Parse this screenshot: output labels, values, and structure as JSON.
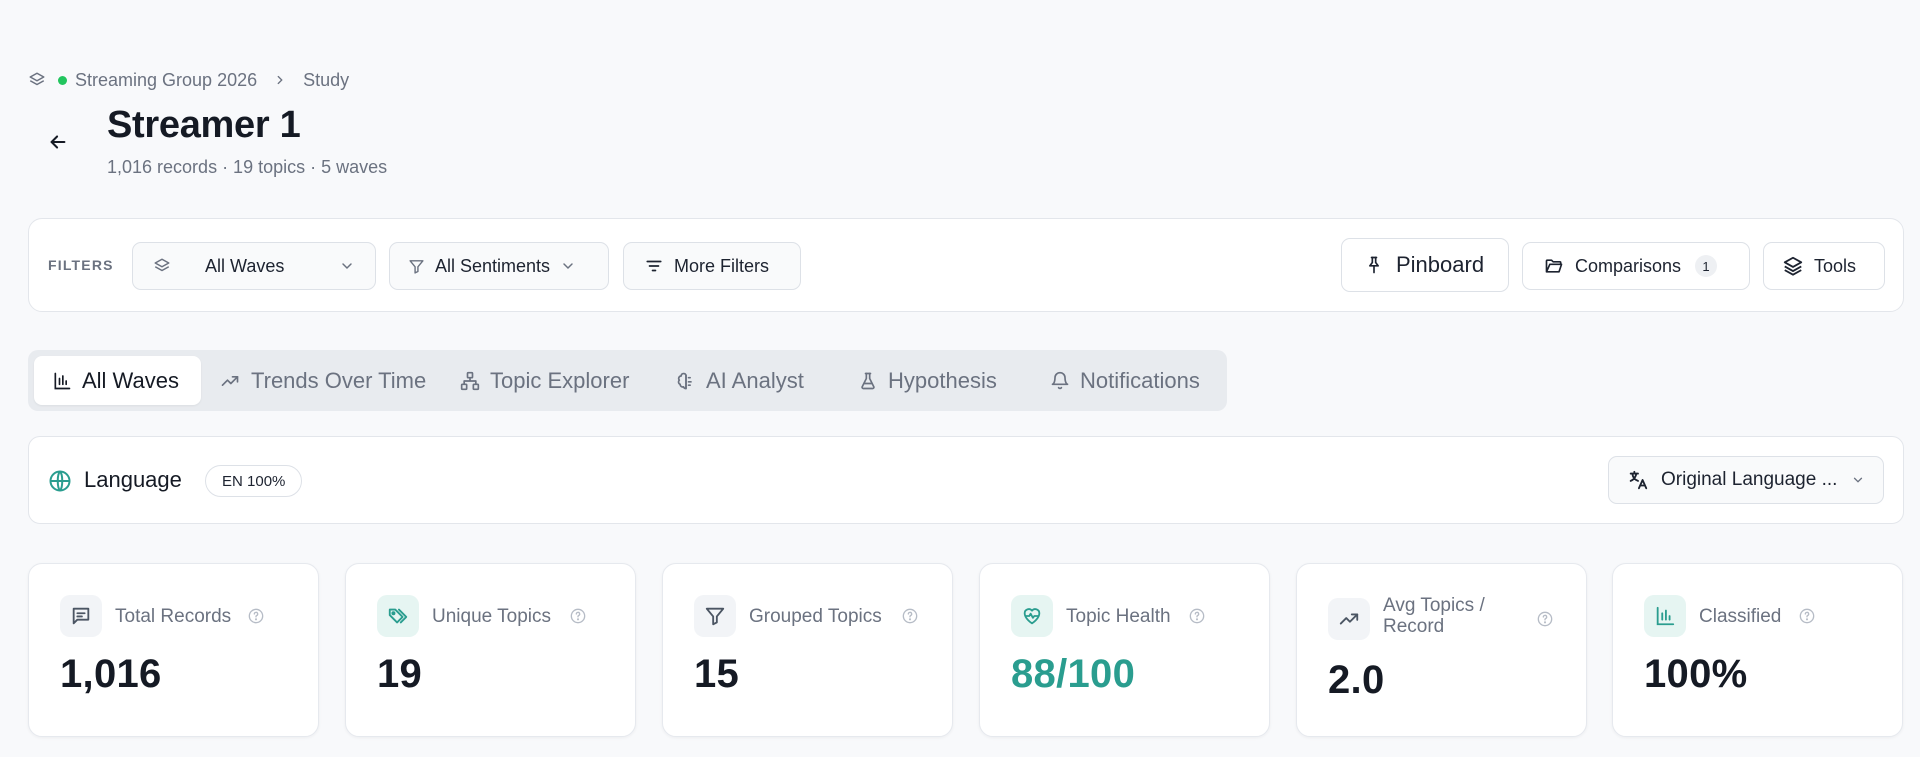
{
  "breadcrumb": {
    "group": "Streaming Group 2026",
    "current": "Study"
  },
  "header": {
    "title": "Streamer 1",
    "subtitle": "1,016 records · 19 topics · 5 waves"
  },
  "filters": {
    "label": "FILTERS",
    "waves": "All Waves",
    "sentiments": "All Sentiments",
    "more": "More Filters",
    "pinboard": "Pinboard",
    "comparisons": "Comparisons",
    "comparisons_count": "1",
    "tools": "Tools"
  },
  "tabs": [
    {
      "label": "All Waves",
      "icon": "bar-chart-icon",
      "active": true
    },
    {
      "label": "Trends Over Time",
      "icon": "trending-up-icon"
    },
    {
      "label": "Topic Explorer",
      "icon": "network-icon"
    },
    {
      "label": "AI Analyst",
      "icon": "brain-icon"
    },
    {
      "label": "Hypothesis",
      "icon": "flask-icon"
    },
    {
      "label": "Notifications",
      "icon": "bell-icon"
    }
  ],
  "language": {
    "title": "Language",
    "badge": "EN 100%",
    "select": "Original Language ..."
  },
  "stats": [
    {
      "label": "Total Records",
      "value": "1,016"
    },
    {
      "label": "Unique Topics",
      "value": "19"
    },
    {
      "label": "Grouped Topics",
      "value": "15"
    },
    {
      "label": "Topic Health",
      "value": "88/100"
    },
    {
      "label": "Avg Topics / Record",
      "value": "2.0"
    },
    {
      "label": "Classified",
      "value": "100%"
    }
  ],
  "colors": {
    "accent": "#2a9d8f",
    "status_dot": "#22c55e",
    "muted_text": "#6b7280"
  }
}
